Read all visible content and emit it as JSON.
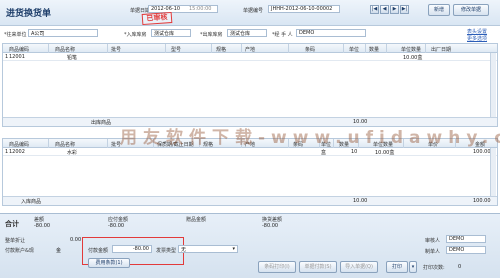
{
  "header": {
    "title": "进货换货单",
    "date_label": "单据日期",
    "date_value": "2012-06-10",
    "time_value": "15:00:00",
    "docno_label": "单据编号",
    "docno_value": "JHHH-2012-06-10-00002",
    "stamp_text": "已审核",
    "nav": [
      "|◀",
      "◀",
      "▶",
      "▶|"
    ],
    "new_label": "新增",
    "modify_label": "修改单据"
  },
  "form": {
    "vendor_label": "*往来单位",
    "vendor_value": "A公司",
    "in_wh_label": "*入库库房",
    "in_wh_value": "测试仓库",
    "out_wh_label": "*出库库房",
    "out_wh_value": "测试仓库",
    "handler_label": "*经 手 人",
    "handler_value": "DEMO",
    "links": [
      "表头设置",
      "更多选项"
    ]
  },
  "out_grid": {
    "columns": [
      "",
      "商品编码",
      "商品名称",
      "批号",
      "型号",
      "规格",
      "产地",
      "条码",
      "单位",
      "数量",
      "单位数量",
      "出厂日期"
    ],
    "rows": [
      [
        "1",
        "12001",
        "铅笔",
        "",
        "",
        "",
        "",
        "",
        "",
        "",
        "10.00盒",
        ""
      ]
    ],
    "total_label": "出库商品",
    "total_value": "10.00"
  },
  "in_grid": {
    "columns": [
      "",
      "商品编码",
      "商品名称",
      "批号",
      "保质期/截止日期",
      "规格",
      "产地",
      "条码",
      "单位",
      "数量",
      "单位数量",
      "单价",
      "金额"
    ],
    "rows": [
      [
        "1",
        "12002",
        "水彩",
        "",
        "",
        "",
        "",
        "",
        "盒",
        "10",
        "10.00盒",
        "",
        "100.00"
      ]
    ],
    "total_label": "入库商品",
    "total_qty": "10.00",
    "total_amount": "100.00"
  },
  "watermark": "用友软件下载-www.ufidawhy.com",
  "bottom": {
    "heji_label": "合计",
    "diff_label": "差额",
    "diff_value": "-80.00",
    "payable_label": "应付金额",
    "payable_value": "-80.00",
    "gift_label": "赠品金额",
    "exchange_label": "换货差额",
    "exchange_value": "-80.00",
    "discount_label": "整单折让",
    "discount_value": "0.00",
    "account_label": "付款账户&现",
    "account_value": "金",
    "pay_label": "付款金额",
    "pay_value": "-80.00",
    "invoice_label": "发票类型",
    "invoice_value": "无",
    "fee_button": "费用条款(1)",
    "reviewer_label": "审核人",
    "reviewer_value": "DEMO",
    "maker_label": "制单人",
    "maker_value": "DEMO",
    "btn_barcode": "条码打印(I)",
    "btn_pay": "单据付款(S)",
    "btn_import": "导入单据(Q)",
    "btn_print": "打印",
    "print_count_label": "打印次数:",
    "print_count_value": "0"
  }
}
